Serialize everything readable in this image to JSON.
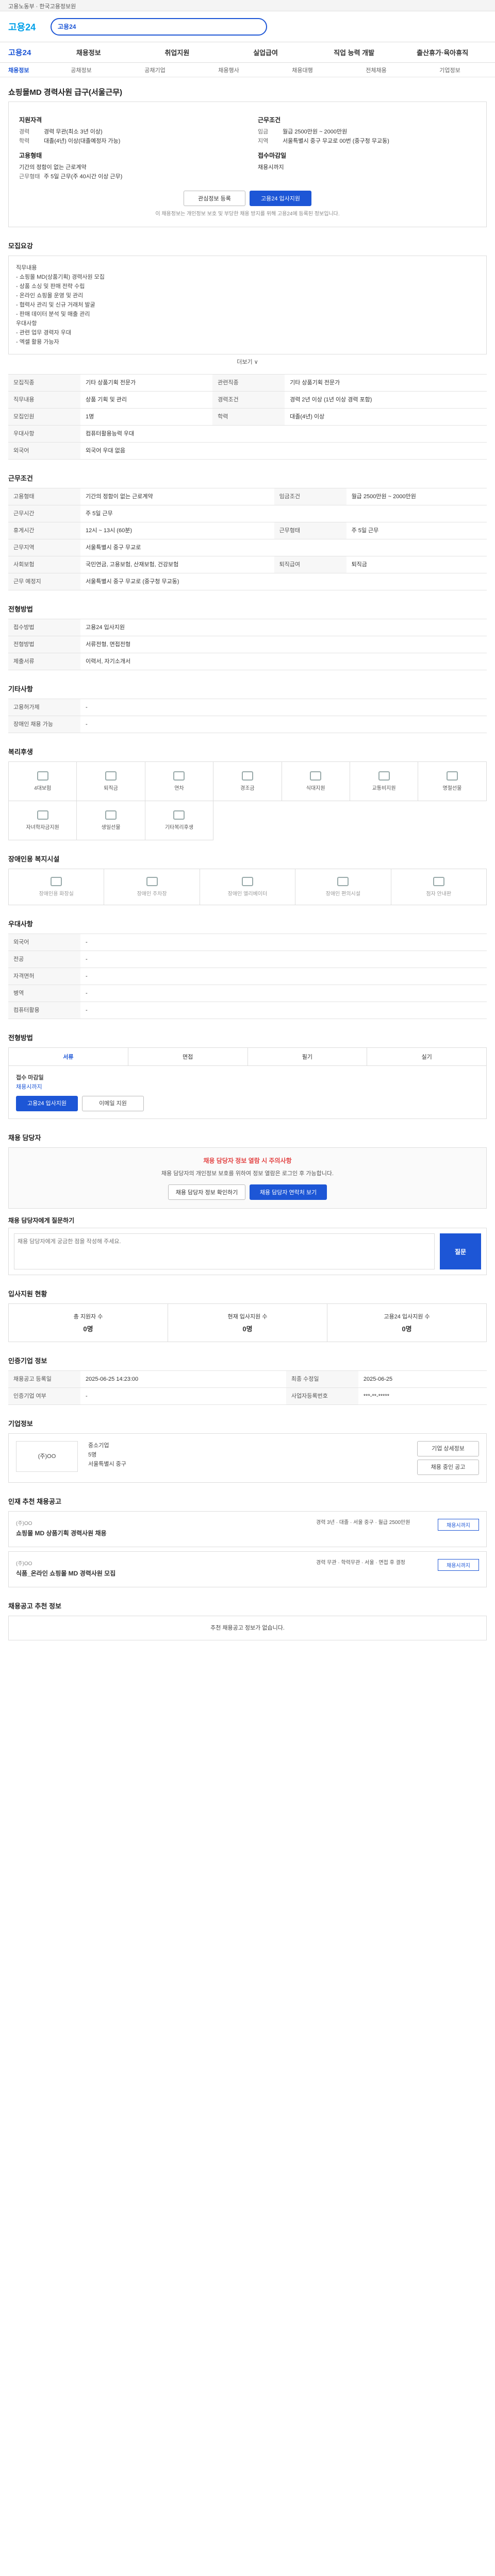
{
  "topbar": {
    "text": "고용노동부 · 한국고용정보원"
  },
  "header": {
    "logo_a": "고용",
    "logo_b": "24",
    "search": "고용24"
  },
  "gnb": [
    "채용정보",
    "취업지원",
    "실업급여",
    "직업 능력 개발",
    "출산휴가·육아휴직"
  ],
  "subnav": [
    "채용정보",
    "공채정보",
    "공채기업",
    "채용행사",
    "채용대행",
    "전체채용",
    "기업정보"
  ],
  "job": {
    "title": "쇼핑몰MD 경력사원 급구(서울근무)",
    "company_t": "지원자격",
    "work_t": "근무조건",
    "k1": "경력",
    "v1": "경력 무관(최소 3년 이상)",
    "k2": "학력",
    "v2": "대졸(4년) 이상(대졸예정자 가능)",
    "k3": "임금",
    "v3": "월급 2500만원 ~ 2000만원",
    "k4": "지역",
    "v4": "서울특별시 중구 무교로 00번 (중구청 무교동)",
    "emp_t": "고용형태",
    "emp": "기간의 정함이 없는 근로계약",
    "ot_t": "근무형태",
    "ot": "주 5일 근무(주 40시간 이상 근무)",
    "deadline_t": "접수마감일",
    "deadline": "채용시까지",
    "btn_save": "관심정보 등록",
    "btn_apply": "고용24 입사지원",
    "note": "이 채용정보는 개인정보 보호 및 부당한 채용 방지를 위해 고용24에 등록된 정보입니다."
  },
  "s_detail": {
    "title": "모집요강",
    "body": "직무내용\n- 쇼핑몰 MD(상품기획) 경력사원 모집\n- 상품 소싱 및 판매 전략 수립\n- 온라인 쇼핑몰 운영 및 관리\n- 협력사 관리 및 신규 거래처 발굴\n- 판매 데이터 분석 및 매출 관리\n우대사항\n- 관련 업무 경력자 우대\n- 엑셀 활용 가능자",
    "more": "더보기 ∨"
  },
  "s_req": {
    "rows": [
      [
        "모집직종",
        "기타 상품기획 전문가",
        "관련직종",
        "기타 상품기획 전문가"
      ],
      [
        "직무내용",
        "상품 기획 및 관리",
        "경력조건",
        "경력 2년 이상 (1년 이상 경력 포함)"
      ],
      [
        "모집인원",
        "1명",
        "학력",
        "대졸(4년) 이상"
      ],
      [
        "우대사항",
        "컴퓨터활용능력 우대",
        "",
        ""
      ],
      [
        "외국어",
        "외국어 우대 없음",
        "",
        ""
      ]
    ]
  },
  "s_cond": {
    "title": "근무조건",
    "rows": [
      [
        "고용형태",
        "기간의 정함이 없는 근로계약",
        "임금조건",
        "월급 2500만원 ~ 2000만원"
      ],
      [
        "근무시간",
        "주 5일 근무",
        "",
        ""
      ],
      [
        "휴게시간",
        "12시 ~ 13시 (60분)",
        "근무형태",
        "주 5일 근무"
      ],
      [
        "근무지역",
        "서울특별시 중구 무교로",
        "",
        ""
      ],
      [
        "사회보험",
        "국민연금, 고용보험, 산재보험, 건강보험",
        "퇴직급여",
        "퇴직금"
      ],
      [
        "근무 예정지",
        "서울특별시 중구 무교로 (중구청 무교동)",
        "",
        ""
      ]
    ]
  },
  "s_apply": {
    "title": "전형방법",
    "rows": [
      [
        "접수방법",
        "고용24 입사지원"
      ],
      [
        "전형방법",
        "서류전형, 면접전형"
      ],
      [
        "제출서류",
        "이력서, 자기소개서"
      ]
    ]
  },
  "s_etc": {
    "title": "기타사항",
    "rows": [
      [
        "고용허가제",
        "-"
      ],
      [
        "장애인 채용 가능",
        "-"
      ]
    ]
  },
  "welfare": {
    "title": "복리후생",
    "items": [
      "4대보험",
      "퇴직금",
      "연차",
      "경조금",
      "식대지원",
      "교통비지원",
      "명절선물",
      "자녀학자금지원",
      "생일선물",
      "기타복리후생"
    ]
  },
  "env": {
    "title": "장애인용 복지시설",
    "items": [
      "장애인용 화장실",
      "장애인 주차장",
      "장애인 엘리베이터",
      "장애인 편의시설",
      "점자 안내판"
    ]
  },
  "prefer": {
    "title": "우대사항",
    "rows": [
      [
        "외국어",
        "-"
      ],
      [
        "전공",
        "-"
      ],
      [
        "자격면허",
        "-"
      ],
      [
        "병역",
        "-"
      ],
      [
        "컴퓨터활용",
        "-"
      ]
    ]
  },
  "method": {
    "title": "전형방법",
    "tabs": [
      "서류",
      "면접",
      "필기",
      "실기"
    ],
    "apply_t": "접수 마감일",
    "apply": "채용시까지",
    "btn1": "고용24 입사지원",
    "btn2": "이메일 지원"
  },
  "contact": {
    "title": "채용 담당자",
    "alert": "채용 담당자 정보 열람 시 주의사항",
    "desc": "채용 담당자의 개인정보 보호를 위하여 정보 열람은 로그인 후 가능합니다.",
    "btn1": "채용 담당자 정보 확인하기",
    "btn2": "채용 담당자 연락처 보기",
    "q_t": "채용 담당자에게 질문하기",
    "q_ph": "채용 담당자에게 궁금한 점을 작성해 주세요.",
    "send": "질문"
  },
  "status": {
    "title": "입사지원 현황",
    "a": "총 지원자 수",
    "av": "0명",
    "b": "현재 입사지원 수",
    "bv": "0명",
    "c": "고용24 입사지원 수",
    "cv": "0명"
  },
  "info": {
    "title": "인증기업 정보",
    "rows": [
      [
        "채용공고 등록일",
        "2025-06-25 14:23:00",
        "최종 수정일",
        "2025-06-25"
      ],
      [
        "인증기업 여부",
        "-",
        "사업자등록번호",
        "***-**-*****"
      ]
    ]
  },
  "company": {
    "title": "기업정보",
    "name": "(주)OO",
    "type": "중소기업",
    "employees": "5명",
    "capital": "-",
    "sales": "-",
    "address": "서울특별시 중구",
    "btn1": "기업 상세정보",
    "btn2": "채용 중인 공고"
  },
  "recommend": {
    "title": "인재 추천 채용공고",
    "more": "전체보기 >",
    "items": [
      {
        "c": "(주)OO",
        "n": "쇼핑몰 MD 상품기획 경력사원 채용",
        "m": "경력 3년 · 대졸 · 서울 중구 · 월급 2500만원",
        "d": "채용시까지"
      },
      {
        "c": "(주)OO",
        "n": "식품_온라인 쇼핑몰 MD 경력사원 모집",
        "m": "경력 무관 · 학력무관 · 서울 · 면접 후 결정",
        "d": "채용시까지"
      }
    ]
  },
  "footer": {
    "title": "채용공고 추천 정보",
    "text": "추천 채용공고 정보가 없습니다."
  }
}
